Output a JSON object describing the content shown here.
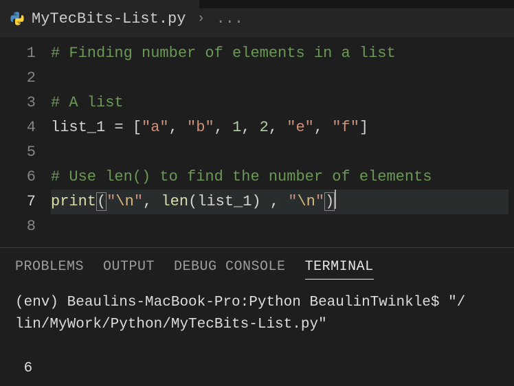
{
  "breadcrumb": {
    "filename": "MyTecBits-List.py",
    "chevron": "›",
    "rest": "..."
  },
  "editor": {
    "active_line": 7,
    "lines": {
      "l1": {
        "num": "1",
        "comment": "# Finding number of elements in a list"
      },
      "l2": {
        "num": "2"
      },
      "l3": {
        "num": "3",
        "comment": "# A list"
      },
      "l4": {
        "num": "4",
        "ident": "list_1",
        "eq": " = ",
        "open": "[",
        "s_a": "\"a\"",
        "c1": ", ",
        "s_b": "\"b\"",
        "c2": ", ",
        "n1": "1",
        "c3": ", ",
        "n2": "2",
        "c4": ", ",
        "s_e": "\"e\"",
        "c5": ", ",
        "s_f": "\"f\"",
        "close": "]"
      },
      "l5": {
        "num": "5"
      },
      "l6": {
        "num": "6",
        "comment": "# Use len() to find the number of elements"
      },
      "l7": {
        "num": "7",
        "func": "print",
        "lp": "(",
        "q1a": "\"",
        "esc1": "\\n",
        "q1b": "\"",
        "c1": ", ",
        "len": "len",
        "lp2": "(",
        "arg": "list_1",
        "rp2": ")",
        "c2": " , ",
        "q2a": "\"",
        "esc2": "\\n",
        "q2b": "\"",
        "rp": ")"
      },
      "l8": {
        "num": "8"
      }
    }
  },
  "panel": {
    "tabs": {
      "problems": "PROBLEMS",
      "output": "OUTPUT",
      "debug": "DEBUG CONSOLE",
      "terminal": "TERMINAL"
    },
    "active_tab": "terminal"
  },
  "terminal": {
    "line1": "(env) Beaulins-MacBook-Pro:Python BeaulinTwinkle$ \"/",
    "line2": "lin/MyWork/Python/MyTecBits-List.py\"",
    "blank": "",
    "result": " 6"
  }
}
